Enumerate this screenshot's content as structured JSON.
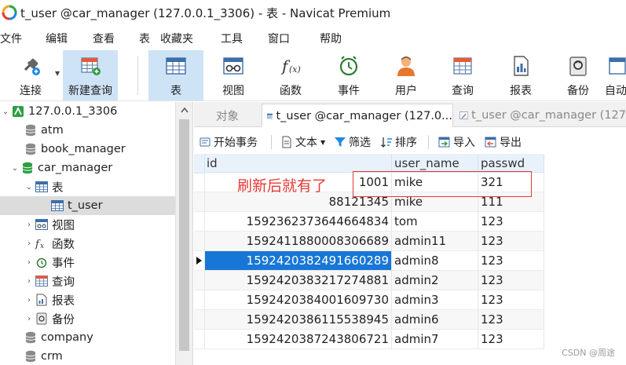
{
  "window": {
    "title": "t_user @car_manager (127.0.0.1_3306) - 表 - Navicat Premium"
  },
  "menu": [
    "文件",
    "编辑",
    "查看",
    "表",
    "收藏夹",
    "工具",
    "窗口",
    "帮助"
  ],
  "toolbar": {
    "connect": "连接",
    "new_query": "新建查询",
    "table": "表",
    "view": "视图",
    "function": "函数",
    "event": "事件",
    "user": "用户",
    "query": "查询",
    "report": "报表",
    "backup": "备份",
    "automation": "自动"
  },
  "nav": {
    "connection": "127.0.0.1_3306",
    "db_atm": "atm",
    "db_book": "book_manager",
    "db_car": "car_manager",
    "tables_group": "表",
    "table_t_user": "t_user",
    "views": "视图",
    "functions": "函数",
    "events": "事件",
    "queries": "查询",
    "reports": "报表",
    "backups": "备份",
    "db_company": "company",
    "db_crm": "crm"
  },
  "tabs": {
    "objects": "对象",
    "tab1": "t_user @car_manager (127.0...",
    "tab2": "t_user @car_manager (127"
  },
  "data_toolbar": {
    "begin_tx": "开始事务",
    "text": "文本",
    "filter": "筛选",
    "sort": "排序",
    "import": "导入",
    "export": "导出"
  },
  "grid": {
    "columns": [
      "id",
      "user_name",
      "passwd"
    ],
    "rows": [
      [
        "1001",
        "mike",
        "321"
      ],
      [
        "88121345",
        "mike",
        "111"
      ],
      [
        "1592362373644664834",
        "tom",
        "123"
      ],
      [
        "1592411880008306689",
        "admin11",
        "123"
      ],
      [
        "1592420382491660289",
        "admin8",
        "123"
      ],
      [
        "1592420383217274881",
        "admin2",
        "123"
      ],
      [
        "1592420384001609730",
        "admin3",
        "123"
      ],
      [
        "1592420386115538945",
        "admin6",
        "123"
      ],
      [
        "1592420387243806721",
        "admin7",
        "123"
      ]
    ]
  },
  "annotation": "刷新后就有了",
  "watermark": "CSDN @周途",
  "colors": {
    "selected_cell": "#1877d6",
    "header_bg": "#e9f1fb",
    "annotation": "#e53935",
    "toolbar_active": "#cfe3f7"
  }
}
